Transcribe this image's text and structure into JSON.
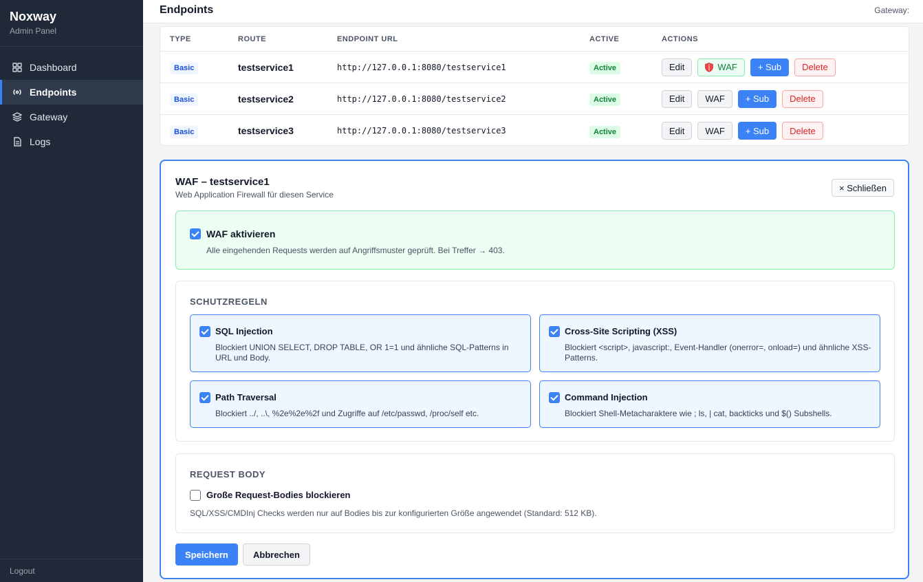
{
  "brand": {
    "name": "Noxway",
    "subtitle": "Admin Panel"
  },
  "sidebar": {
    "items": [
      {
        "label": "Dashboard",
        "icon": "grid-icon"
      },
      {
        "label": "Endpoints",
        "icon": "broadcast-icon",
        "active": true
      },
      {
        "label": "Gateway",
        "icon": "layers-icon"
      },
      {
        "label": "Logs",
        "icon": "document-icon"
      }
    ],
    "logout": "Logout"
  },
  "header": {
    "title": "Endpoints",
    "gateway_label": "Gateway:"
  },
  "table": {
    "columns": [
      "TYPE",
      "ROUTE",
      "ENDPOINT URL",
      "ACTIVE",
      "ACTIONS"
    ],
    "rows": [
      {
        "type": "Basic",
        "route": "testservice1",
        "url": "http://127.0.0.1:8080/testservice1",
        "active": "Active"
      },
      {
        "type": "Basic",
        "route": "testservice2",
        "url": "http://127.0.0.1:8080/testservice2",
        "active": "Active"
      },
      {
        "type": "Basic",
        "route": "testservice3",
        "url": "http://127.0.0.1:8080/testservice3",
        "active": "Active"
      }
    ],
    "actions": {
      "edit": "Edit",
      "waf": "WAF",
      "sub": "+ Sub",
      "delete": "Delete"
    }
  },
  "waf": {
    "title": "WAF – testservice1",
    "subtitle": "Web Application Firewall für diesen Service",
    "close": "× Schließen",
    "enable": {
      "label": "WAF aktivieren",
      "checked": true,
      "description": "Alle eingehenden Requests werden auf Angriffsmuster geprüft. Bei Treffer → 403."
    },
    "rules_title": "SCHUTZREGELN",
    "rules": [
      {
        "title": "SQL Injection",
        "checked": true,
        "description": "Blockiert UNION SELECT, DROP TABLE, OR 1=1 und ähnliche SQL-Patterns in URL und Body."
      },
      {
        "title": "Cross-Site Scripting (XSS)",
        "checked": true,
        "description": "Blockiert <script>, javascript:, Event-Handler (onerror=, onload=) und ähnliche XSS-Patterns."
      },
      {
        "title": "Path Traversal",
        "checked": true,
        "description": "Blockiert ../, ..\\, %2e%2e%2f und Zugriffe auf /etc/passwd, /proc/self etc."
      },
      {
        "title": "Command Injection",
        "checked": true,
        "description": "Blockiert Shell-Metacharaktere wie ; ls, | cat, backticks und $() Subshells."
      }
    ],
    "body_title": "REQUEST BODY",
    "body_option": {
      "label": "Große Request-Bodies blockieren",
      "checked": false
    },
    "body_desc": "SQL/XSS/CMDInj Checks werden nur auf Bodies bis zur konfigurierten Größe angewendet (Standard: 512 KB).",
    "save": "Speichern",
    "cancel": "Abbrechen"
  },
  "colors": {
    "accent": "#3b82f6",
    "sidebar_bg": "#1f2937",
    "success": "#15803d",
    "danger": "#dc2626"
  }
}
